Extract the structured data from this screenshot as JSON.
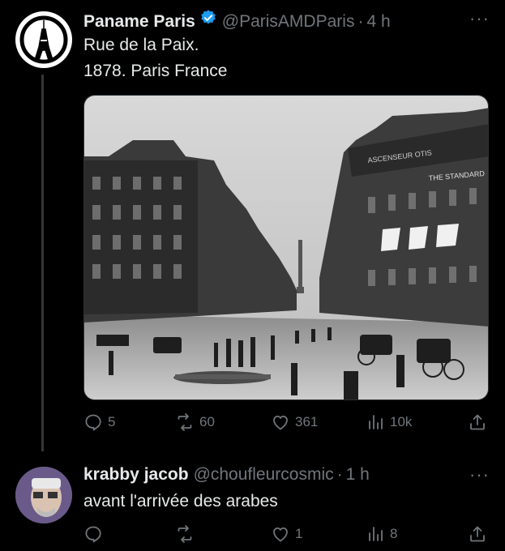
{
  "tweets": [
    {
      "name": "Paname Paris",
      "handle": "@ParisAMDParis",
      "time": "4 h",
      "verified": true,
      "text_lines": [
        "Rue de la Paix.",
        "1878. Paris France"
      ],
      "has_media": true,
      "media_signs": [
        "ASCENSEUR OTIS",
        "THE STANDARD"
      ],
      "stats": {
        "replies": "5",
        "reposts": "60",
        "likes": "361",
        "views": "10k"
      }
    },
    {
      "name": "krabby jacob",
      "handle": "@choufleurcosmic",
      "time": "1 h",
      "verified": false,
      "text_lines": [
        "avant l'arrivée des arabes"
      ],
      "has_media": false,
      "stats": {
        "replies": "",
        "reposts": "",
        "likes": "1",
        "views": "8"
      }
    }
  ],
  "ui": {
    "separator": "·",
    "more": "···"
  },
  "colors": {
    "background": "#000000",
    "text": "#e7e9ea",
    "muted": "#71767b",
    "verified": "#1d9bf0",
    "line": "#333639"
  }
}
